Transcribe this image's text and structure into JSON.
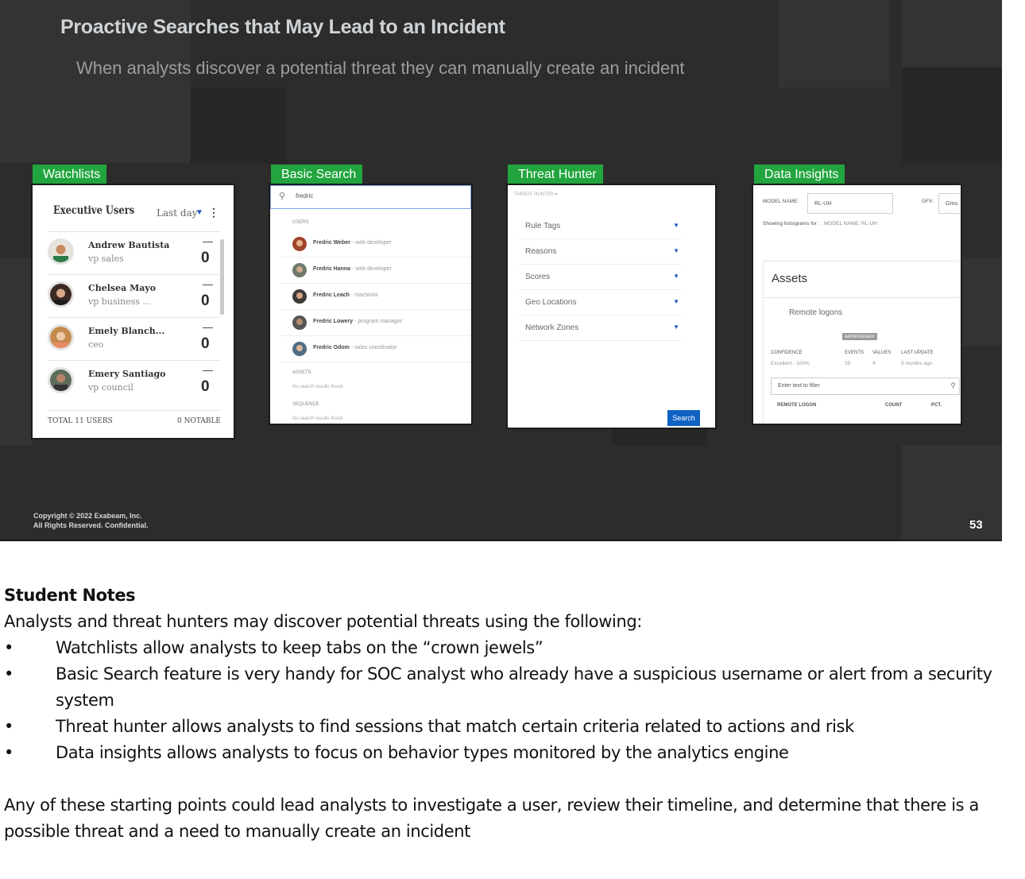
{
  "slide": {
    "title": "Proactive Searches that May Lead to an Incident",
    "subtitle": "When analysts discover a potential threat they can manually create an incident",
    "copyright_line1": "Copyright © 2022 Exabeam, Inc.",
    "copyright_line2": "All Rights Reserved. Confidential.",
    "page_number": "53",
    "accent_color": "#22a53e",
    "background_color": "#2c2c2c"
  },
  "panels": {
    "watchlists": {
      "label": "Watchlists",
      "heading": "Executive Users",
      "time_range": "Last day",
      "users": [
        {
          "name": "Andrew Bautista",
          "role": "vp sales",
          "dash": "—",
          "score": "0"
        },
        {
          "name": "Chelsea Mayo",
          "role": "vp business ...",
          "dash": "—",
          "score": "0"
        },
        {
          "name": "Emely Blanch...",
          "role": "ceo",
          "dash": "—",
          "score": "0"
        },
        {
          "name": "Emery Santiago",
          "role": "vp council",
          "dash": "—",
          "score": "0"
        }
      ],
      "total": "TOTAL 11 USERS",
      "notable": "0 NOTABLE"
    },
    "basic_search": {
      "label": "Basic Search",
      "query": "fredric",
      "users_section": "USERS",
      "results": [
        {
          "name": "Fredric Weber",
          "role": " - web developer"
        },
        {
          "name": "Fredric Hanna",
          "role": " - web developer"
        },
        {
          "name": "Fredric Leach",
          "role": " - machinist"
        },
        {
          "name": "Fredric Lowery",
          "role": " - program manager"
        },
        {
          "name": "Fredric Odom",
          "role": " - sales coordinator"
        }
      ],
      "assets_section": "ASSETS",
      "assets_empty": "No search results found.",
      "sequence_section": "SEQUENCE",
      "sequence_empty": "No search results found."
    },
    "threat_hunter": {
      "label": "Threat Hunter",
      "menu": "THREAT HUNTER ▾",
      "filters": [
        "Rule Tags",
        "Reasons",
        "Scores",
        "Geo Locations",
        "Network Zones"
      ],
      "search_button": "Search"
    },
    "data_insights": {
      "label": "Data Insights",
      "model_name_label": "MODEL NAME:",
      "model_name_value": "RL-UH",
      "gfv_label": "GFV:",
      "gfv_value": "Grou",
      "showing": "Showing histograms for :",
      "model_name_small": "MODEL NAME: RL-UH",
      "assets_title": "Assets",
      "remote_logons": "Remote logons",
      "tag": "administrator",
      "confidence_label": "CONFIDENCE",
      "confidence_value": "Excellent - 100%",
      "events_label": "EVENTS",
      "events_value": "39",
      "values_label": "VALUES",
      "values_value": "4",
      "last_update_label": "LAST UPDATE",
      "last_update_value": "9 months ago",
      "filter_placeholder": "Enter text to filter",
      "col_remote_logon": "REMOTE LOGON",
      "col_count": "COUNT",
      "col_pct": "PCT."
    }
  },
  "notes": {
    "heading": "Student Notes",
    "intro": "Analysts and threat hunters may discover potential threats using the following:",
    "bullet_char": "•",
    "bullets": [
      "Watchlists allow analysts to keep tabs on the “crown jewels”",
      "Basic Search feature is very handy for SOC analyst who already have a suspicious username or alert from a security system",
      "Threat hunter allows analysts to find sessions that match certain criteria related to actions and risk",
      "Data insights allows analysts to focus on behavior types monitored by the analytics engine"
    ],
    "closing": "Any of these starting points could lead analysts to investigate a user, review their timeline, and determine that there is a possible threat and a need to manually create an incident"
  }
}
